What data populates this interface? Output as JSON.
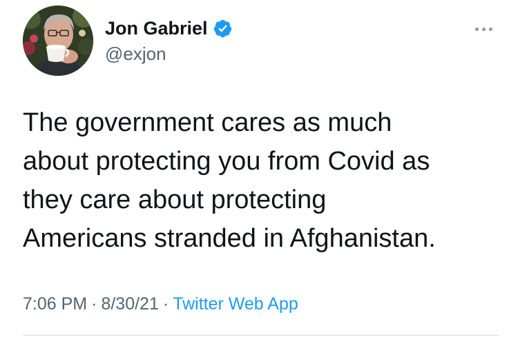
{
  "author": {
    "display_name": "Jon Gabriel",
    "handle": "@exjon",
    "verified": true,
    "avatar_icon": "avatar-man-drinking-coffee"
  },
  "tweet": {
    "text": "The government cares as much\nabout protecting you from Covid as\nthey care about protecting\nAmericans stranded in Afghanistan."
  },
  "meta": {
    "time": "7:06 PM",
    "separator": "·",
    "date": "8/30/21",
    "source": "Twitter Web App"
  },
  "colors": {
    "text_primary": "#0f1419",
    "text_secondary": "#536471",
    "link": "#1d9bf0",
    "verified_badge": "#1d9bf0",
    "divider": "#cfd9de"
  },
  "icons": {
    "more": "more-horizontal-icon",
    "verified": "verified-badge-icon"
  }
}
